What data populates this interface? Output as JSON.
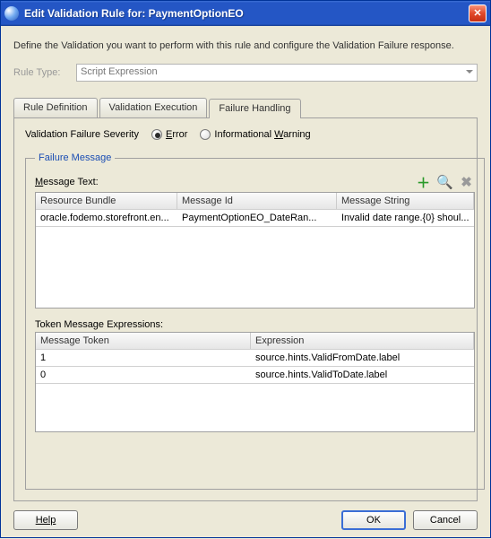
{
  "titlebar": {
    "title": "Edit Validation Rule for: PaymentOptionEO"
  },
  "intro": "Define the Validation you want to perform with this rule and configure the Validation Failure response.",
  "ruleType": {
    "label": "Rule Type:",
    "value": "Script Expression"
  },
  "tabs": {
    "definition": "Rule Definition",
    "execution": "Validation Execution",
    "failure": "Failure Handling"
  },
  "severity": {
    "label": "Validation Failure Severity",
    "error_prefix": "E",
    "error_rest": "rror",
    "warn_prefix": "Informational ",
    "warn_u": "W",
    "warn_rest": "arning"
  },
  "failureMessage": {
    "legend": "Failure Message",
    "messageTextLabel_u": "M",
    "messageTextLabel_rest": "essage Text:",
    "headers": {
      "bundle": "Resource Bundle",
      "id": "Message Id",
      "str": "Message String"
    },
    "rows": [
      {
        "bundle": "oracle.fodemo.storefront.en...",
        "id": "PaymentOptionEO_DateRan...",
        "str": "Invalid date range.{0} shoul..."
      }
    ],
    "tokenLabel": "Token Message Expressions:",
    "tokenHeaders": {
      "token": "Message Token",
      "expr": "Expression"
    },
    "tokenRows": [
      {
        "token": "1",
        "expr": "source.hints.ValidFromDate.label"
      },
      {
        "token": "0",
        "expr": "source.hints.ValidToDate.label"
      }
    ]
  },
  "buttons": {
    "help": "Help",
    "ok": "OK",
    "cancel": "Cancel"
  }
}
